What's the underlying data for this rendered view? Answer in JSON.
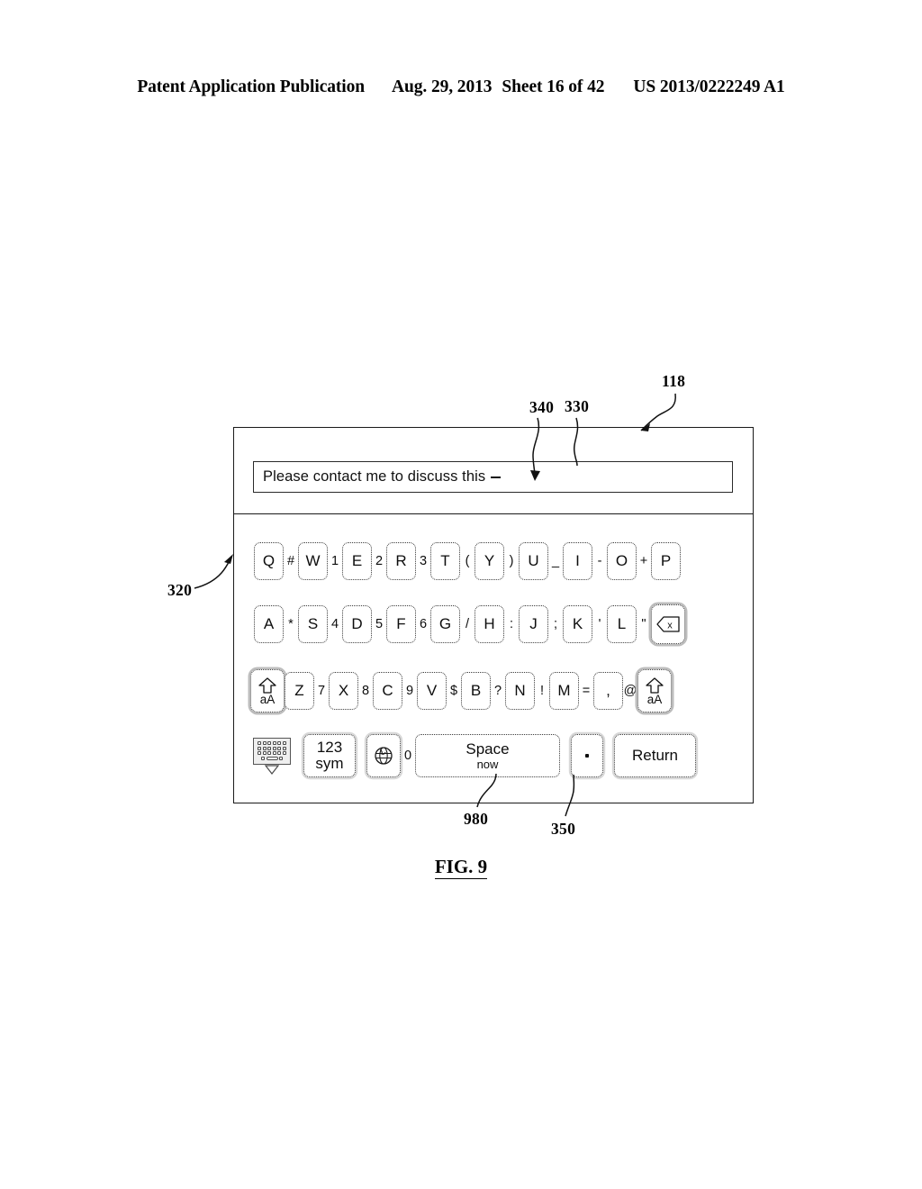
{
  "header": {
    "publication": "Patent Application Publication",
    "date": "Aug. 29, 2013",
    "sheet": "Sheet 16 of 42",
    "number": "US 2013/0222249 A1"
  },
  "figure": {
    "caption": "FIG. 9",
    "reference_numerals": {
      "device": "118",
      "cursor": "340",
      "text_field": "330",
      "keyboard": "320",
      "suggestion": "980",
      "space_key": "350"
    }
  },
  "device": {
    "text_field": {
      "value": "Please contact me to discuss this ",
      "cursor": "caret"
    },
    "keyboard": {
      "row1": [
        {
          "type": "key",
          "label": "Q",
          "name": "key-q"
        },
        {
          "type": "sym",
          "label": "#",
          "name": "sym-hash"
        },
        {
          "type": "key",
          "label": "W",
          "name": "key-w"
        },
        {
          "type": "sym",
          "label": "1",
          "name": "sym-1"
        },
        {
          "type": "key",
          "label": "E",
          "name": "key-e"
        },
        {
          "type": "sym",
          "label": "2",
          "name": "sym-2"
        },
        {
          "type": "key",
          "label": "R",
          "name": "key-r"
        },
        {
          "type": "sym",
          "label": "3",
          "name": "sym-3"
        },
        {
          "type": "key",
          "label": "T",
          "name": "key-t"
        },
        {
          "type": "sym",
          "label": "(",
          "name": "sym-paren-open"
        },
        {
          "type": "key",
          "label": "Y",
          "name": "key-y"
        },
        {
          "type": "sym",
          "label": ")",
          "name": "sym-paren-close"
        },
        {
          "type": "key",
          "label": "U",
          "name": "key-u"
        },
        {
          "type": "sym",
          "label": "_",
          "name": "sym-underscore"
        },
        {
          "type": "key",
          "label": "I",
          "name": "key-i"
        },
        {
          "type": "sym",
          "label": "-",
          "name": "sym-hyphen"
        },
        {
          "type": "key",
          "label": "O",
          "name": "key-o"
        },
        {
          "type": "sym",
          "label": "+",
          "name": "sym-plus"
        },
        {
          "type": "key",
          "label": "P",
          "name": "key-p"
        }
      ],
      "row2": [
        {
          "type": "key",
          "label": "A",
          "name": "key-a"
        },
        {
          "type": "sym",
          "label": "*",
          "name": "sym-asterisk"
        },
        {
          "type": "key",
          "label": "S",
          "name": "key-s"
        },
        {
          "type": "sym",
          "label": "4",
          "name": "sym-4"
        },
        {
          "type": "key",
          "label": "D",
          "name": "key-d"
        },
        {
          "type": "sym",
          "label": "5",
          "name": "sym-5"
        },
        {
          "type": "key",
          "label": "F",
          "name": "key-f"
        },
        {
          "type": "sym",
          "label": "6",
          "name": "sym-6"
        },
        {
          "type": "key",
          "label": "G",
          "name": "key-g"
        },
        {
          "type": "sym",
          "label": "/",
          "name": "sym-slash"
        },
        {
          "type": "key",
          "label": "H",
          "name": "key-h"
        },
        {
          "type": "sym",
          "label": ":",
          "name": "sym-colon"
        },
        {
          "type": "key",
          "label": "J",
          "name": "key-j"
        },
        {
          "type": "sym",
          "label": ";",
          "name": "sym-semicolon"
        },
        {
          "type": "key",
          "label": "K",
          "name": "key-k"
        },
        {
          "type": "sym",
          "label": "'",
          "name": "sym-apostrophe"
        },
        {
          "type": "key",
          "label": "L",
          "name": "key-l"
        },
        {
          "type": "sym",
          "label": "\"",
          "name": "sym-quote"
        },
        {
          "type": "backspace",
          "label": "",
          "name": "key-backspace"
        }
      ],
      "row3": [
        {
          "type": "shift",
          "label": "aA",
          "name": "key-shift-left"
        },
        {
          "type": "key",
          "label": "Z",
          "name": "key-z"
        },
        {
          "type": "sym",
          "label": "7",
          "name": "sym-7"
        },
        {
          "type": "key",
          "label": "X",
          "name": "key-x"
        },
        {
          "type": "sym",
          "label": "8",
          "name": "sym-8"
        },
        {
          "type": "key",
          "label": "C",
          "name": "key-c"
        },
        {
          "type": "sym",
          "label": "9",
          "name": "sym-9"
        },
        {
          "type": "key",
          "label": "V",
          "name": "key-v"
        },
        {
          "type": "sym",
          "label": "$",
          "name": "sym-dollar"
        },
        {
          "type": "key",
          "label": "B",
          "name": "key-b"
        },
        {
          "type": "sym",
          "label": "?",
          "name": "sym-question"
        },
        {
          "type": "key",
          "label": "N",
          "name": "key-n"
        },
        {
          "type": "sym",
          "label": "!",
          "name": "sym-exclaim"
        },
        {
          "type": "key",
          "label": "M",
          "name": "key-m"
        },
        {
          "type": "sym",
          "label": "=",
          "name": "sym-equals"
        },
        {
          "type": "key",
          "label": ",",
          "name": "key-comma"
        },
        {
          "type": "sym",
          "label": "@",
          "name": "sym-at"
        },
        {
          "type": "shift",
          "label": "aA",
          "name": "key-shift-right"
        }
      ],
      "row4": {
        "dismiss": {
          "name": "key-dismiss-keyboard"
        },
        "numeric": {
          "line1": "123",
          "line2": "sym",
          "name": "key-123-sym"
        },
        "globe": {
          "name": "key-globe"
        },
        "zero_sym": "0",
        "space": {
          "label": "Space",
          "suggestion": "now",
          "name": "key-space"
        },
        "period": {
          "label": ".",
          "name": "key-period"
        },
        "return": {
          "label": "Return",
          "name": "key-return"
        }
      }
    }
  }
}
